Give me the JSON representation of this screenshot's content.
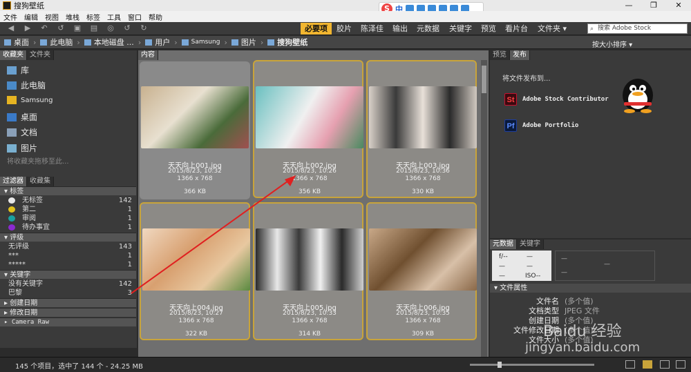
{
  "window": {
    "title": "搜狗壁纸"
  },
  "menu": [
    "文件",
    "编辑",
    "视图",
    "堆栈",
    "标签",
    "工具",
    "窗口",
    "帮助"
  ],
  "sogou": {
    "label": "中"
  },
  "workspaces": [
    "必要项",
    "胶片",
    "陈泽佳",
    "输出",
    "元数据",
    "关键字",
    "预览",
    "看片台",
    "文件夹 ▾"
  ],
  "search": {
    "placeholder": "搜索 Adobe Stock"
  },
  "breadcrumb": [
    "桌面",
    "此电脑",
    "本地磁盘 ...",
    "用户",
    "Samsung",
    "图片",
    "搜狗壁纸"
  ],
  "sort": {
    "label": "按大小排序 ▾"
  },
  "left_tabs": [
    "收藏夹",
    "文件夹"
  ],
  "favorites": {
    "items": [
      "库",
      "此电脑",
      "Samsung",
      "桌面",
      "文档",
      "图片"
    ],
    "hint": "将收藏夹拖移至此..."
  },
  "filter_tabs": [
    "过滤器",
    "收藏集"
  ],
  "filters": {
    "labels_head": "标签",
    "labels": [
      {
        "name": "无标签",
        "count": "142",
        "color": "#e8e8e8"
      },
      {
        "name": "第二",
        "count": "1",
        "color": "#e2c21c"
      },
      {
        "name": "审阅",
        "count": "1",
        "color": "#1aa0a0"
      },
      {
        "name": "待办事宜",
        "count": "1",
        "color": "#8a2ad0"
      }
    ],
    "ratings_head": "评级",
    "ratings": [
      {
        "name": "无评级",
        "count": "143"
      },
      {
        "name": "***",
        "count": "1"
      },
      {
        "name": "*****",
        "count": "1"
      }
    ],
    "keywords_head": "关键字",
    "keywords": [
      {
        "name": "没有关键字",
        "count": "142"
      },
      {
        "name": "巴黎",
        "count": "3"
      }
    ],
    "date_created": "创建日期",
    "date_modified": "修改日期",
    "camera_raw": "Camera Raw"
  },
  "content": {
    "tab": "内容",
    "thumbs": [
      {
        "name": "天天向上001.jpg",
        "date": "2015/8/23, 10:32",
        "dim": "1366 x 768",
        "size": "366 KB"
      },
      {
        "name": "天天向上002.jpg",
        "date": "2015/8/23, 10:26",
        "dim": "1366 x 768",
        "size": "356 KB"
      },
      {
        "name": "天天向上003.jpg",
        "date": "2015/8/23, 10:36",
        "dim": "1366 x 768",
        "size": "330 KB"
      },
      {
        "name": "天天向上004.jpg",
        "date": "2015/8/23, 10:27",
        "dim": "1366 x 768",
        "size": "322 KB"
      },
      {
        "name": "天天向上005.jpg",
        "date": "2015/8/23, 10:33",
        "dim": "1366 x 768",
        "size": "314 KB"
      },
      {
        "name": "天天向上006.jpg",
        "date": "2015/8/23, 10:35",
        "dim": "1366 x 768",
        "size": "309 KB"
      }
    ]
  },
  "right_tabs": [
    "预览",
    "发布"
  ],
  "publish": {
    "title": "将文件发布到...",
    "items": [
      {
        "badge": "St",
        "label": "Adobe Stock Contributor",
        "color": "#c8102e"
      },
      {
        "badge": "Pf",
        "label": "Adobe Portfolio",
        "color": "#1d3e9e"
      }
    ]
  },
  "meta_tabs": [
    "元数据",
    "关键字"
  ],
  "exif": {
    "f": "f/--",
    "iso": "ISO--"
  },
  "file_props": {
    "head": "文件属性",
    "rows": [
      {
        "key": "文件名",
        "val": "(多个值)"
      },
      {
        "key": "文档类型",
        "val": "JPEG 文件"
      },
      {
        "key": "创建日期",
        "val": "(多个值)"
      },
      {
        "key": "文件修改日期",
        "val": "(多个值)"
      },
      {
        "key": "文件大小",
        "val": "(多个值)"
      }
    ]
  },
  "status": {
    "text": "145 个项目，选中了 144 个 - 24.25 MB"
  },
  "watermark": {
    "line1": "Baidu 经验",
    "line2": "jingyan.baidu.com"
  }
}
